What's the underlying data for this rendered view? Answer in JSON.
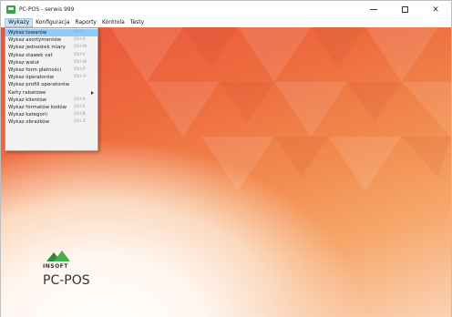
{
  "window": {
    "title": "PC-POS - serwis 999",
    "controls": {
      "minimize": "–",
      "maximize": "□",
      "close": "✕"
    }
  },
  "menubar": {
    "items": [
      {
        "label": "Wykazy",
        "active": true
      },
      {
        "label": "Konfiguracja",
        "active": false
      },
      {
        "label": "Raporty",
        "active": false
      },
      {
        "label": "Kontrola",
        "active": false
      },
      {
        "label": "Testy",
        "active": false
      }
    ]
  },
  "dropdown": {
    "items": [
      {
        "label": "Wykaz towarów",
        "shortcut": "Ctrl-T",
        "highlighted": true
      },
      {
        "label": "Wykaz asortymentów",
        "shortcut": "Ctrl-A"
      },
      {
        "label": "Wykaz jednostek miary",
        "shortcut": "Ctrl-M"
      },
      {
        "label": "Wykaz stawek vat",
        "shortcut": "Ctrl-V"
      },
      {
        "label": "Wykaz walut",
        "shortcut": "Ctrl-W"
      },
      {
        "label": "Wykaz form płatności",
        "shortcut": "Ctrl-P"
      },
      {
        "label": "Wykaz operatorów",
        "shortcut": "Ctrl-O"
      },
      {
        "label": "Wykaz profili operatorów",
        "shortcut": ""
      },
      {
        "label": "Karty rabatowe",
        "shortcut": "",
        "submenu": true
      },
      {
        "label": "Wykaz klientów",
        "shortcut": "Ctrl-K"
      },
      {
        "label": "Wykaz formatów kodów",
        "shortcut": "Ctrl-E"
      },
      {
        "label": "Wykaz kategorii",
        "shortcut": "Ctrl-B"
      },
      {
        "label": "Wykaz obrazków",
        "shortcut": "Ctrl-Z"
      }
    ]
  },
  "logo": {
    "brand": "INSOFT",
    "product": "PC-POS"
  },
  "colors": {
    "accent": "#ee6a3f",
    "highlight": "#91c9f7",
    "logo_green": "#4aae4f"
  },
  "icons": {
    "app": "pc-pos-app-icon",
    "submenu": "submenu-arrow-icon"
  }
}
